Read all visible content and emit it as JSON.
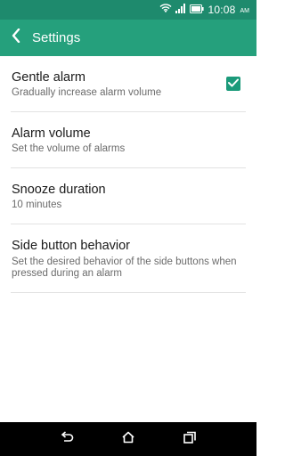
{
  "statusbar": {
    "time": "10:08",
    "ampm": "AM",
    "icons": [
      "wifi-icon",
      "signal-icon",
      "battery-icon"
    ]
  },
  "appbar": {
    "title": "Settings",
    "back_icon": "chevron-left-icon"
  },
  "settings": [
    {
      "title": "Gentle alarm",
      "subtitle": "Gradually increase alarm volume",
      "checked": true
    },
    {
      "title": "Alarm volume",
      "subtitle": "Set the volume of alarms"
    },
    {
      "title": "Snooze duration",
      "subtitle": "10 minutes"
    },
    {
      "title": "Side button behavior",
      "subtitle": "Set the desired behavior of the side buttons when pressed during an alarm"
    }
  ],
  "navbar": {
    "buttons": [
      "back-icon",
      "home-icon",
      "recents-icon"
    ]
  },
  "colors": {
    "statusbar": "#1e8a6d",
    "appbar": "#25a07c",
    "accent": "#1b9a7a"
  }
}
